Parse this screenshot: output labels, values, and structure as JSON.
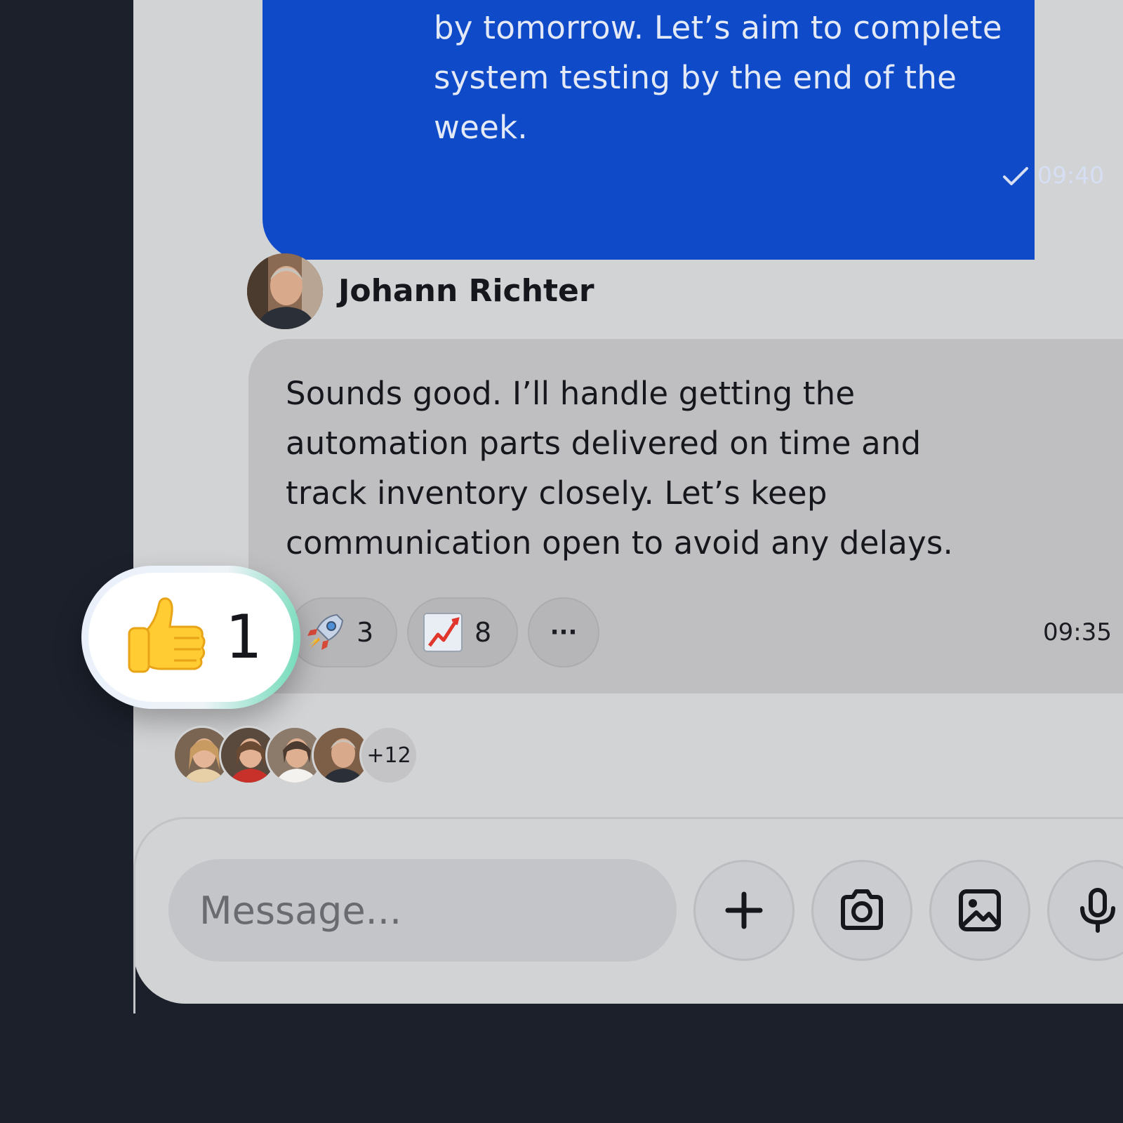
{
  "outgoing_message": {
    "text": "by tomorrow. Let’s aim to complete\nsystem testing by the end of the\nweek.",
    "time": "09:40",
    "status_icon": "check-icon",
    "bubble_color": "#0f4bc9"
  },
  "incoming_message": {
    "sender": "Johann Richter",
    "text": "Sounds good. I’ll handle getting the\nautomation parts delivered on time and\ntrack inventory closely. Let’s keep\ncommunication open to avoid any delays.",
    "time": "09:35"
  },
  "reactions": {
    "thumbs_up": {
      "icon": "thumbs-up-icon",
      "count": "1"
    },
    "rocket": {
      "icon": "rocket-icon",
      "count": "3"
    },
    "chart": {
      "icon": "chart-increasing-icon",
      "count": "8"
    },
    "more_label": "···"
  },
  "reactors": {
    "more_label": "+12"
  },
  "composer": {
    "placeholder": "Message...",
    "buttons": [
      "plus-icon",
      "camera-icon",
      "image-icon",
      "microphone-icon"
    ]
  },
  "colors": {
    "background": "#1b202b",
    "panel": "#d2d3d5",
    "accent_gradient_end": "#68d9b4"
  }
}
